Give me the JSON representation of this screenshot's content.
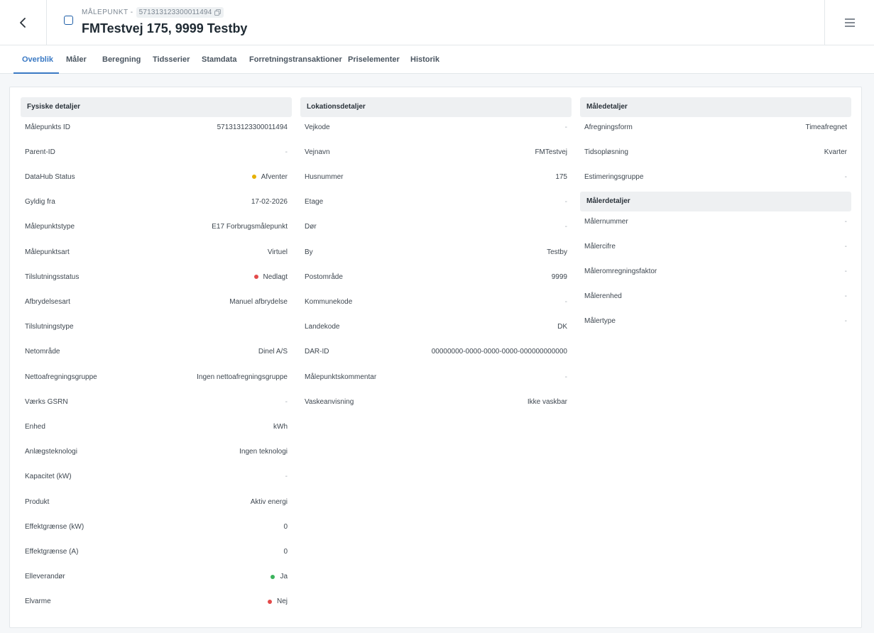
{
  "header": {
    "crumb_label": "MÅLEPUNKT -",
    "crumb_id": "571313123300011494",
    "title": "FMTestvej 175, 9999 Testby"
  },
  "tabs": [
    {
      "label": "Overblik"
    },
    {
      "label": "Måler"
    },
    {
      "label": "Beregning"
    },
    {
      "label": "Tidsserier"
    },
    {
      "label": "Stamdata"
    },
    {
      "label": "Forretningstransaktioner"
    },
    {
      "label": "Priselementer"
    },
    {
      "label": "Historik"
    }
  ],
  "colors": {
    "accent": "#3a79c4",
    "status_yellow": "#e6b000",
    "status_red": "#e34a4a",
    "status_green": "#3bb35c"
  },
  "fysiske": {
    "title": "Fysiske detaljer",
    "rows": [
      {
        "label": "Målepunkts ID",
        "value": "571313123300011494"
      },
      {
        "label": "Parent-ID",
        "value": "-"
      },
      {
        "label": "DataHub Status",
        "value": "Afventer",
        "status": "yellow"
      },
      {
        "label": "Gyldig fra",
        "value": "17-02-2026"
      },
      {
        "label": "Målepunktstype",
        "value": "E17 Forbrugsmålepunkt"
      },
      {
        "label": "Målepunktsart",
        "value": "Virtuel"
      },
      {
        "label": "Tilslutningsstatus",
        "value": "Nedlagt",
        "status": "red"
      },
      {
        "label": "Afbrydelsesart",
        "value": "Manuel afbrydelse"
      },
      {
        "label": "Tilslutningstype",
        "value": ""
      },
      {
        "label": "Netområde",
        "value": "Dinel A/S"
      },
      {
        "label": "Nettoafregningsgruppe",
        "value": "Ingen nettoafregningsgruppe"
      },
      {
        "label": "Værks GSRN",
        "value": "-"
      },
      {
        "label": "Enhed",
        "value": "kWh"
      },
      {
        "label": "Anlægsteknologi",
        "value": "Ingen teknologi"
      },
      {
        "label": "Kapacitet (kW)",
        "value": "-"
      },
      {
        "label": "Produkt",
        "value": "Aktiv energi"
      },
      {
        "label": "Effektgrænse (kW)",
        "value": "0"
      },
      {
        "label": "Effektgrænse (A)",
        "value": "0"
      },
      {
        "label": "Elleverandør",
        "value": "Ja",
        "status": "green"
      },
      {
        "label": "Elvarme",
        "value": "Nej",
        "status": "red"
      }
    ]
  },
  "lokation": {
    "title": "Lokationsdetaljer",
    "rows": [
      {
        "label": "Vejkode",
        "value": "-"
      },
      {
        "label": "Vejnavn",
        "value": "FMTestvej"
      },
      {
        "label": "Husnummer",
        "value": "175"
      },
      {
        "label": "Etage",
        "value": "-"
      },
      {
        "label": "Dør",
        "value": "-"
      },
      {
        "label": "By",
        "value": "Testby"
      },
      {
        "label": "Postområde",
        "value": "9999"
      },
      {
        "label": "Kommunekode",
        "value": "-"
      },
      {
        "label": "Landekode",
        "value": "DK"
      },
      {
        "label": "DAR-ID",
        "value": "00000000-0000-0000-0000-000000000000"
      },
      {
        "label": "Målepunktskommentar",
        "value": "-"
      },
      {
        "label": "Vaskeanvisning",
        "value": "Ikke vaskbar"
      }
    ]
  },
  "maaledetaljer": {
    "title": "Måledetaljer",
    "rows": [
      {
        "label": "Afregningsform",
        "value": "Timeafregnet"
      },
      {
        "label": "Tidsopløsning",
        "value": "Kvarter"
      },
      {
        "label": "Estimeringsgruppe",
        "value": "-"
      }
    ]
  },
  "maalerdetaljer": {
    "title": "Målerdetaljer",
    "rows": [
      {
        "label": "Målernummer",
        "value": "-"
      },
      {
        "label": "Målercifre",
        "value": "-"
      },
      {
        "label": "Måleromregningsfaktor",
        "value": "-"
      },
      {
        "label": "Målerenhed",
        "value": "-"
      },
      {
        "label": "Målertype",
        "value": "-"
      }
    ]
  }
}
